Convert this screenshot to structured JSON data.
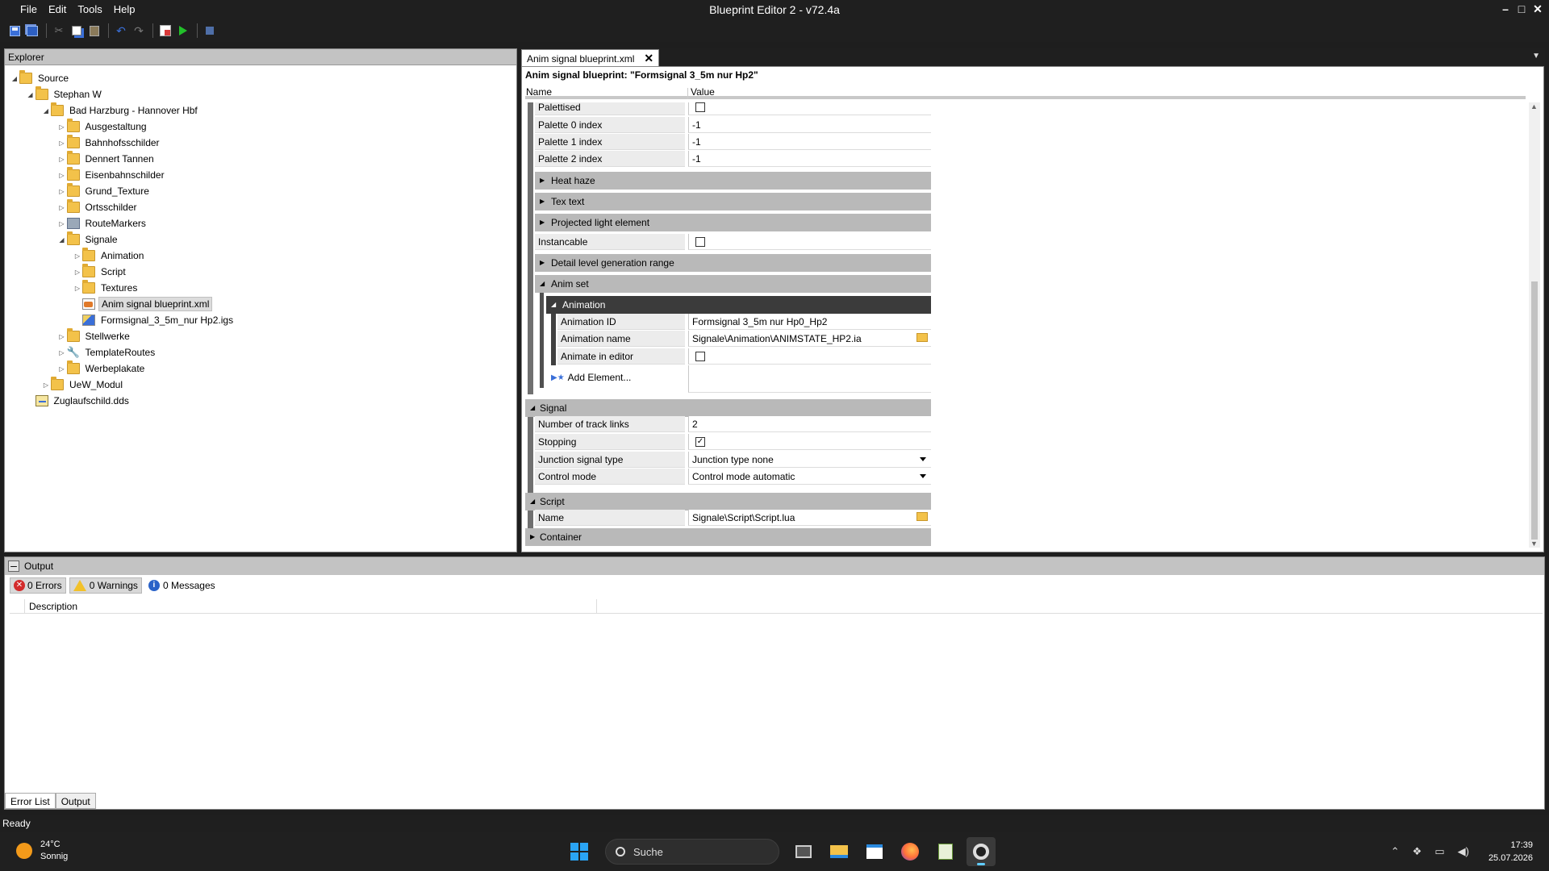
{
  "window": {
    "title": "Blueprint Editor 2 - v72.4a",
    "menu": [
      "File",
      "Edit",
      "Tools",
      "Help"
    ],
    "controls": {
      "minimize": "–",
      "maximize": "□",
      "close": "✕"
    }
  },
  "explorer": {
    "title": "Explorer",
    "tree": [
      {
        "label": "Source",
        "depth": 0,
        "expanded": true,
        "icon": "folder-icon"
      },
      {
        "label": "Stephan W",
        "depth": 1,
        "expanded": true,
        "icon": "folder-icon"
      },
      {
        "label": "Bad Harzburg - Hannover Hbf",
        "depth": 2,
        "expanded": true,
        "icon": "folder-icon"
      },
      {
        "label": "Ausgestaltung",
        "depth": 3,
        "expanded": false,
        "icon": "folder-icon"
      },
      {
        "label": "Bahnhofsschilder",
        "depth": 3,
        "expanded": false,
        "icon": "folder-icon"
      },
      {
        "label": "Dennert Tannen",
        "depth": 3,
        "expanded": false,
        "icon": "folder-icon"
      },
      {
        "label": "Eisenbahnschilder",
        "depth": 3,
        "expanded": false,
        "icon": "folder-icon"
      },
      {
        "label": "Grund_Texture",
        "depth": 3,
        "expanded": false,
        "icon": "folder-icon"
      },
      {
        "label": "Ortsschilder",
        "depth": 3,
        "expanded": false,
        "icon": "folder-icon"
      },
      {
        "label": "RouteMarkers",
        "depth": 3,
        "expanded": false,
        "icon": "markers-icon"
      },
      {
        "label": "Signale",
        "depth": 3,
        "expanded": true,
        "icon": "folder-icon"
      },
      {
        "label": "Animation",
        "depth": 4,
        "expanded": false,
        "icon": "folder-icon"
      },
      {
        "label": "Script",
        "depth": 4,
        "expanded": false,
        "icon": "folder-icon"
      },
      {
        "label": "Textures",
        "depth": 4,
        "expanded": false,
        "icon": "folder-icon"
      },
      {
        "label": "Anim signal blueprint.xml",
        "depth": 4,
        "leaf": true,
        "selected": true,
        "icon": "xml-icon"
      },
      {
        "label": "Formsignal_3_5m_nur Hp2.igs",
        "depth": 4,
        "leaf": true,
        "icon": "igs-icon"
      },
      {
        "label": "Stellwerke",
        "depth": 3,
        "expanded": false,
        "icon": "folder-icon"
      },
      {
        "label": "TemplateRoutes",
        "depth": 3,
        "expanded": false,
        "icon": "wrench-icon"
      },
      {
        "label": "Werbeplakate",
        "depth": 3,
        "expanded": false,
        "icon": "folder-icon"
      },
      {
        "label": "UeW_Modul",
        "depth": 2,
        "expanded": false,
        "icon": "folder-icon"
      },
      {
        "label": "Zuglaufschild.dds",
        "depth": 1,
        "leaf": true,
        "icon": "dds-icon"
      }
    ]
  },
  "document": {
    "tab_label": "Anim signal blueprint.xml",
    "tab_close": "✕",
    "title": "Anim signal blueprint: \"Formsignal 3_5m nur Hp2\"",
    "columns": {
      "name": "Name",
      "value": "Value"
    },
    "props": {
      "palettised": {
        "name": "Palettised",
        "checked": false
      },
      "palette0": {
        "name": "Palette 0 index",
        "value": "-1"
      },
      "palette1": {
        "name": "Palette 1 index",
        "value": "-1"
      },
      "palette2": {
        "name": "Palette 2 index",
        "value": "-1"
      },
      "heat_haze": "Heat haze",
      "tex_text": "Tex text",
      "projected_light": "Projected light element",
      "instancable": {
        "name": "Instancable",
        "checked": false
      },
      "detail_level": "Detail level generation range",
      "anim_set": "Anim set",
      "animation_group": "Animation",
      "animation_id": {
        "name": "Animation ID",
        "value": "Formsignal 3_5m nur Hp0_Hp2"
      },
      "animation_name": {
        "name": "Animation name",
        "value": "Signale\\Animation\\ANIMSTATE_HP2.ia"
      },
      "animate_in_editor": {
        "name": "Animate in editor",
        "checked": false
      },
      "add_element": "Add Element...",
      "signal_group": "Signal",
      "track_links": {
        "name": "Number of track links",
        "value": "2"
      },
      "stopping": {
        "name": "Stopping",
        "checked": true
      },
      "junction_type": {
        "name": "Junction signal type",
        "value": "Junction type none"
      },
      "control_mode": {
        "name": "Control mode",
        "value": "Control mode automatic"
      },
      "script_group": "Script",
      "script_name": {
        "name": "Name",
        "value": "Signale\\Script\\Script.lua"
      },
      "container": "Container"
    }
  },
  "output": {
    "title": "Output",
    "errors": "0 Errors",
    "warnings": "0 Warnings",
    "messages": "0 Messages",
    "description_header": "Description",
    "tabs": [
      "Error List",
      "Output"
    ]
  },
  "status": "Ready",
  "taskbar": {
    "weather_temp": "24°C",
    "weather_desc": "Sonnig",
    "search_placeholder": "Suche",
    "time": "17:39",
    "date": "25.07.2026"
  }
}
